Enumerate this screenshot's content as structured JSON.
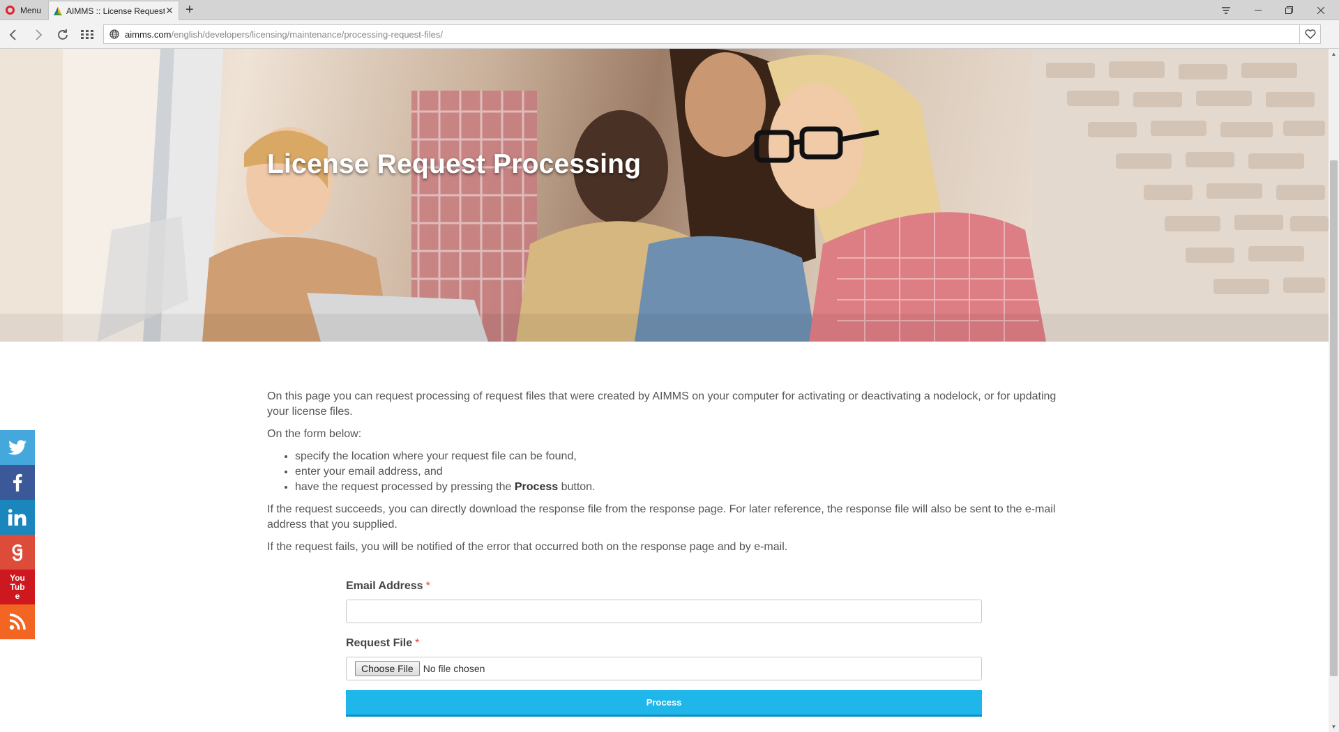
{
  "browser": {
    "menu_label": "Menu",
    "tab_title": "AIMMS :: License Request",
    "url_host": "aimms.com",
    "url_path": "/english/developers/licensing/maintenance/processing-request-files/"
  },
  "hero": {
    "title": "License Request Processing"
  },
  "content": {
    "intro": "On this page you can request processing of request files that were created by AIMMS on your computer for activating or deactivating a nodelock, or for updating your license files.",
    "form_intro": "On the form below:",
    "steps": {
      "step1": "specify the location where your request file can be found,",
      "step2": "enter your email address, and",
      "step3_pre": "have the request processed by pressing the",
      "step3_bold": "Process",
      "step3_post": "button."
    },
    "success_text": "If the request succeeds, you can directly download the response file from the response page. For later reference, the response file will also be sent to the e-mail address that you supplied.",
    "failure_text": "If the request fails, you will be notified of the error that occurred both on the response page and by e-mail."
  },
  "form": {
    "email_label": "Email Address",
    "required_mark": "*",
    "email_value": "",
    "file_label": "Request File",
    "choose_file_label": "Choose File",
    "no_file_text": "No file chosen",
    "submit_label": "Process"
  },
  "social": {
    "colors": {
      "twitter": "#45a8dd",
      "facebook": "#3b5998",
      "linkedin": "#1b86bc",
      "google": "#dd4b39",
      "youtube": "#cc181e",
      "rss": "#f26522"
    },
    "youtube_label": "You Tube"
  },
  "colors": {
    "accent": "#1fb7ea",
    "required": "#e03c3c"
  }
}
